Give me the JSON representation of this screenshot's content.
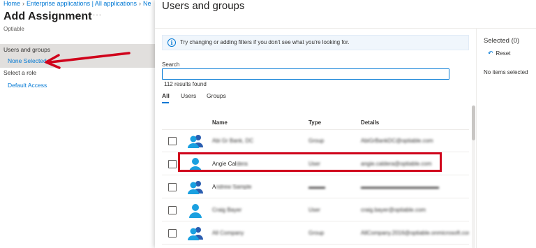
{
  "left_page": {
    "breadcrumb": [
      "Home",
      "Enterprise applications | All applications",
      "Ne"
    ],
    "title": "Add Assignment",
    "more_icon": "more-horizontal-icon",
    "subtitle": "Optiable",
    "users_groups_label": "Users and groups",
    "none_selected": "None Selected",
    "select_role_label": "Select a role",
    "default_access": "Default Access"
  },
  "blade": {
    "title": "Users and groups",
    "info_text": "Try changing or adding filters if you don't see what you're looking for.",
    "info_icon": "info-icon",
    "search_label": "Search",
    "search_value": "",
    "results_text": "112 results found",
    "tabs": [
      {
        "label": "All",
        "active": true
      },
      {
        "label": "Users",
        "active": false
      },
      {
        "label": "Groups",
        "active": false
      }
    ],
    "columns": [
      "Name",
      "Type",
      "Details"
    ],
    "rows": [
      {
        "name": "Abi Gr Bank, DC",
        "type": "Group",
        "details": "AbiGrBankDC@optiable.com",
        "kind": "group",
        "blurred": true
      },
      {
        "name": "Angie Caldera",
        "type": "User",
        "details": "angie.caldera@optiable.com",
        "kind": "user",
        "blurred": "partial",
        "visible_part": "Angie Cal",
        "hidden_part": "dera"
      },
      {
        "name": "A",
        "type": "",
        "details": "",
        "kind": "group",
        "blurred": "partial",
        "visible_part": "A",
        "hidden_part": "ndrew Sample"
      },
      {
        "name": "Craig Bayer",
        "type": "User",
        "details": "craig.bayer@optiable.com",
        "kind": "user",
        "blurred": true
      },
      {
        "name": "All Company",
        "type": "Group",
        "details": "AllCompany.2016@optiable.onmicrosoft.com",
        "kind": "group",
        "blurred": true
      }
    ],
    "right_panel": {
      "selected_title": "Selected (0)",
      "reset_label": "Reset",
      "reset_icon": "undo-icon",
      "empty_text": "No items selected"
    }
  },
  "colors": {
    "accent": "#0078d4",
    "annotation_red": "#d0021b",
    "selected_bg": "#e1dfdd"
  }
}
